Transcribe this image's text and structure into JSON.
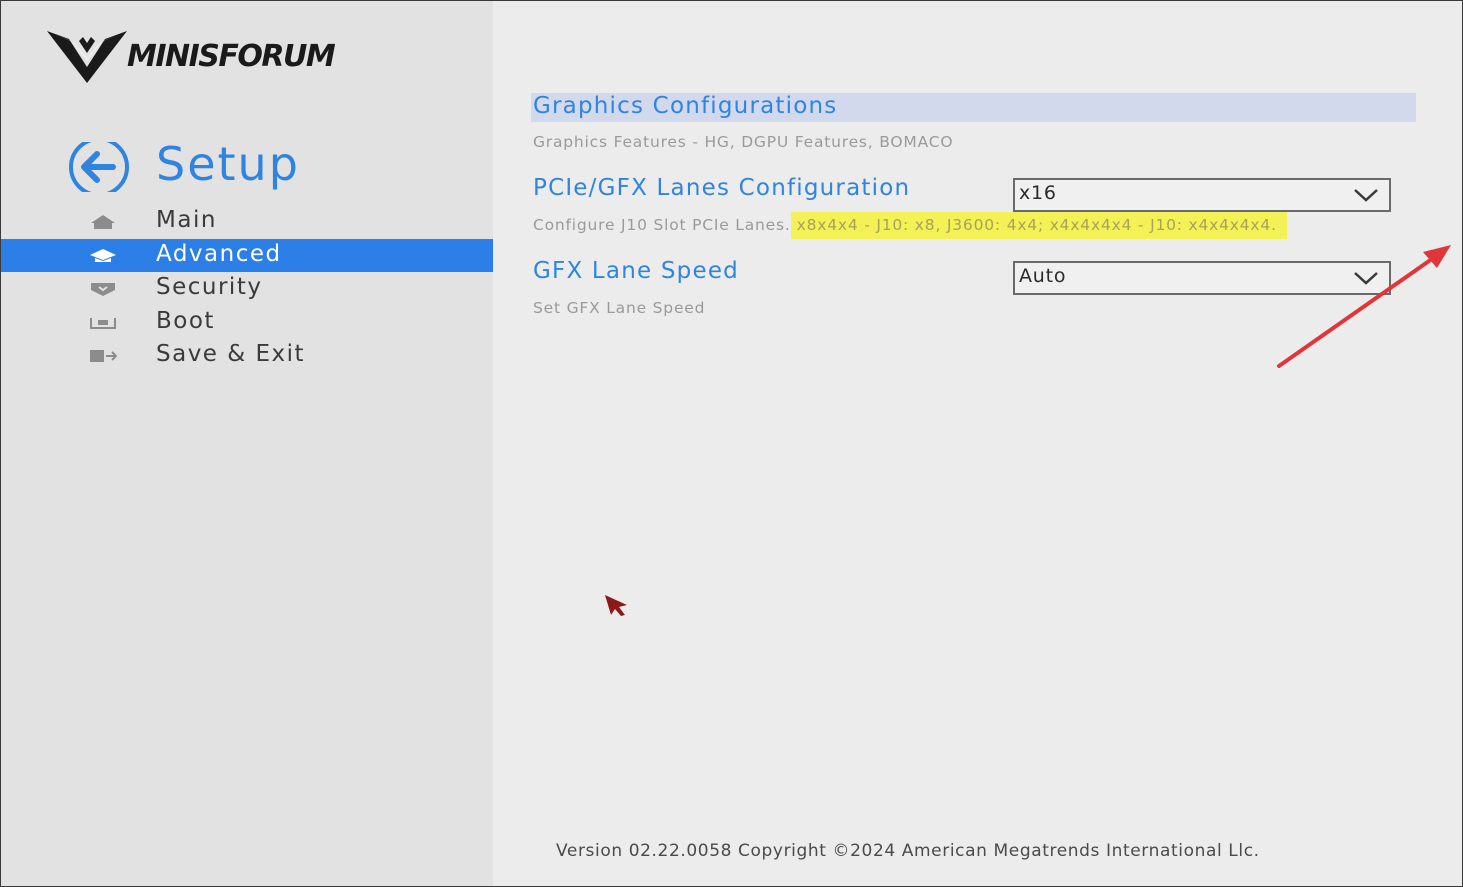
{
  "brand": {
    "logo_text": "MINISFORUM"
  },
  "sidebar": {
    "title": "Setup",
    "items": [
      {
        "label": "Main",
        "icon": "home-icon"
      },
      {
        "label": "Advanced",
        "icon": "advanced-icon",
        "active": true
      },
      {
        "label": "Security",
        "icon": "shield-icon"
      },
      {
        "label": "Boot",
        "icon": "boot-icon"
      },
      {
        "label": "Save & Exit",
        "icon": "exit-icon"
      }
    ]
  },
  "main": {
    "section_title": "Graphics Configurations",
    "section_desc": "Graphics Features - HG, DGPU Features, BOMACO",
    "options": [
      {
        "label": "PCIe/GFX Lanes Configuration",
        "help_prefix": "Configure J10 Slot PCIe Lanes.",
        "help_highlight": "x8x4x4 - J10: x8, J3600: 4x4; x4x4x4x4 - J10: x4x4x4x4.",
        "value": "x16"
      },
      {
        "label": "GFX Lane Speed",
        "help": "Set GFX Lane Speed",
        "value": "Auto"
      }
    ]
  },
  "footer": {
    "version_text": "Version 02.22.0058 Copyright ©2024 American Megatrends International Llc."
  },
  "colors": {
    "accent": "#2f84e0",
    "active_bg": "#2c7fe6",
    "highlight": "#f3f156",
    "annotation_arrow": "#e0363a"
  }
}
